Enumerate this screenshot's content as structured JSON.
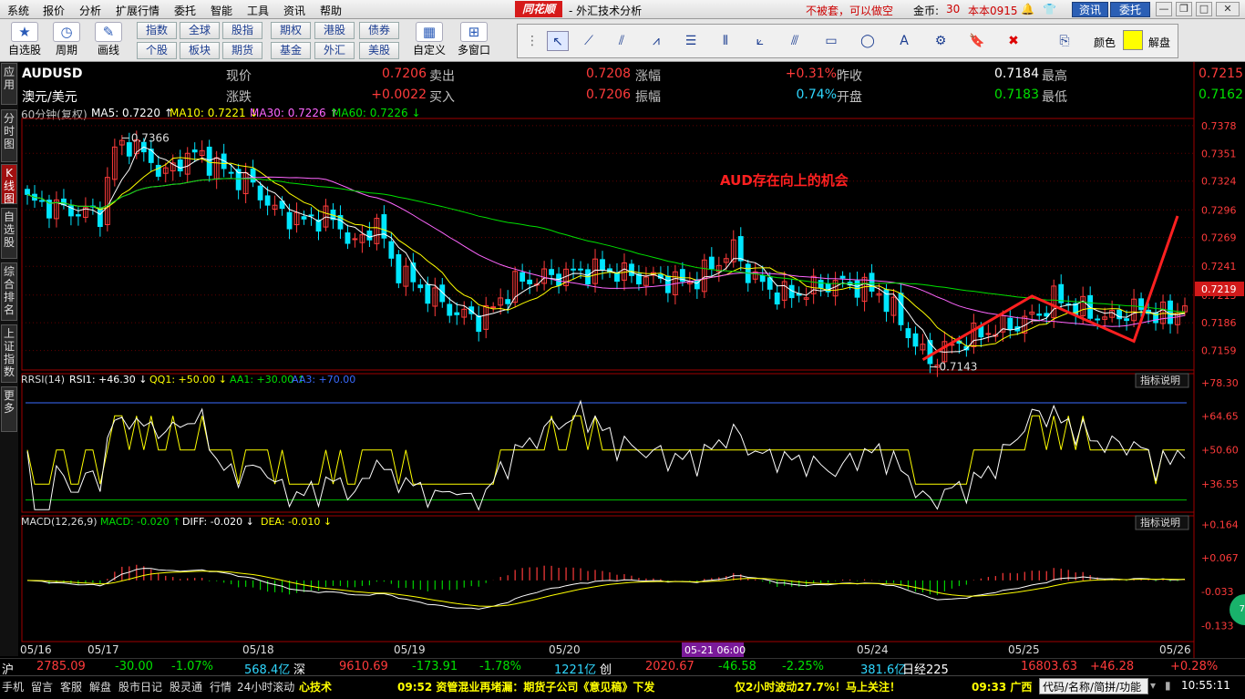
{
  "menu": {
    "items": [
      "系统",
      "报价",
      "分析",
      "扩展行情",
      "委托",
      "智能",
      "工具",
      "资讯",
      "帮助"
    ],
    "brand": "同花顺",
    "title": "- 外汇技术分析",
    "no_trap": "不被套，可以做空",
    "gold_label": "金币:",
    "gold_value": "30",
    "version": "本本0915",
    "news_button": "资讯",
    "trade_button": "委托"
  },
  "toolbar": {
    "big_tools": [
      "自选股",
      "周期",
      "画线"
    ],
    "grid_buttons": [
      [
        "指数",
        "全球",
        "股指",
        "期权",
        "港股",
        "债券"
      ],
      [
        "个股",
        "板块",
        "期货",
        "基金",
        "外汇",
        "美股"
      ]
    ],
    "custom": "自定义",
    "multi_window": "多窗口",
    "color_label": "颜色",
    "unlock_label": "解盘"
  },
  "side_tabs": [
    "应用",
    "分时图",
    "K线图",
    "自选股",
    "综合排名",
    "上证指数",
    "更多"
  ],
  "header": {
    "symbol": "AUDUSD",
    "name": "澳元/美元",
    "period": "60分钟(复权)",
    "rows": [
      [
        {
          "label": "现价",
          "value": "0.7206",
          "color": "red"
        },
        {
          "label": "卖出",
          "value": "0.7208",
          "color": "red"
        },
        {
          "label": "涨幅",
          "value": "+0.31%",
          "color": "red"
        },
        {
          "label": "昨收",
          "value": "0.7184",
          "color": "white"
        },
        {
          "label": "最高",
          "value": "0.7215",
          "color": "red"
        }
      ],
      [
        {
          "label": "涨跌",
          "value": "+0.0022",
          "color": "red"
        },
        {
          "label": "买入",
          "value": "0.7206",
          "color": "red"
        },
        {
          "label": "振幅",
          "value": "0.74%",
          "color": "cyan"
        },
        {
          "label": "开盘",
          "value": "0.7183",
          "color": "green"
        },
        {
          "label": "最低",
          "value": "0.7162",
          "color": "green"
        }
      ]
    ],
    "ma": [
      {
        "text": "MA5: 0.7220",
        "arrow": "↑",
        "color": "white"
      },
      {
        "text": "MA10: 0.7221",
        "arrow": "↓",
        "color": "yellow"
      },
      {
        "text": "MA30: 0.7226",
        "arrow": "↑",
        "color": "magenta"
      },
      {
        "text": "MA60: 0.7226",
        "arrow": "↓",
        "color": "green"
      }
    ]
  },
  "main_chart": {
    "annotation": "AUD存在向上的机会",
    "high_label": "0.7366",
    "low_label": "0.7143",
    "current_tag": "0.7219",
    "y_ticks": [
      "0.7378",
      "0.7351",
      "0.7324",
      "0.7296",
      "0.7269",
      "0.7241",
      "0.7213",
      "0.7186",
      "0.7159"
    ]
  },
  "rsi": {
    "title": "RRSI(14)",
    "items": [
      {
        "text": "RSI1: +46.30",
        "arrow": "↓",
        "color": "white"
      },
      {
        "text": "QQ1: +50.00",
        "arrow": "↓",
        "color": "yellow"
      },
      {
        "text": "AA1: +30.00",
        "arrow": "↑",
        "color": "green"
      },
      {
        "text": "AA3: +70.00",
        "arrow": "",
        "color": "blue"
      }
    ],
    "explain": "指标说明",
    "y_ticks": [
      "+78.30",
      "+64.65",
      "+50.60",
      "+36.55"
    ]
  },
  "macd": {
    "title": "MACD(12,26,9)",
    "items": [
      {
        "text": "MACD: -0.020",
        "arrow": "↑",
        "color": "green"
      },
      {
        "text": "DIFF: -0.020",
        "arrow": "↓",
        "color": "white"
      },
      {
        "text": "DEA: -0.010",
        "arrow": "↓",
        "color": "yellow"
      }
    ],
    "explain": "指标说明",
    "y_ticks": [
      "+0.164",
      "+0.067",
      "-0.033",
      "-0.133"
    ]
  },
  "x_axis": {
    "labels": [
      "05/16",
      "05/17",
      "05/18",
      "05/19",
      "05/20",
      "05/24",
      "05/25",
      "05/26"
    ],
    "cursor": "05-21 06:00"
  },
  "chart_data": {
    "type": "candlestick",
    "symbol": "AUDUSD",
    "period": "60分钟(复权)",
    "ylim": [
      0.714,
      0.7385
    ],
    "x_labels": [
      "05/16",
      "05/17",
      "05/18",
      "05/19",
      "05/20",
      "05/24",
      "05/25",
      "05/26"
    ],
    "close_path": [
      {
        "t": 0,
        "v": 0.7305
      },
      {
        "t": 3,
        "v": 0.73
      },
      {
        "t": 6,
        "v": 0.7295
      },
      {
        "t": 10,
        "v": 0.7292
      },
      {
        "t": 12,
        "v": 0.7355
      },
      {
        "t": 14,
        "v": 0.7362
      },
      {
        "t": 16,
        "v": 0.735
      },
      {
        "t": 19,
        "v": 0.733
      },
      {
        "t": 22,
        "v": 0.735
      },
      {
        "t": 24,
        "v": 0.7348
      },
      {
        "t": 28,
        "v": 0.733
      },
      {
        "t": 31,
        "v": 0.732
      },
      {
        "t": 34,
        "v": 0.7295
      },
      {
        "t": 38,
        "v": 0.7285
      },
      {
        "t": 41,
        "v": 0.729
      },
      {
        "t": 43,
        "v": 0.728
      },
      {
        "t": 45,
        "v": 0.726
      },
      {
        "t": 48,
        "v": 0.7285
      },
      {
        "t": 50,
        "v": 0.7245
      },
      {
        "t": 53,
        "v": 0.7225
      },
      {
        "t": 56,
        "v": 0.721
      },
      {
        "t": 59,
        "v": 0.7195
      },
      {
        "t": 62,
        "v": 0.719
      },
      {
        "t": 64,
        "v": 0.72
      },
      {
        "t": 67,
        "v": 0.7225
      },
      {
        "t": 71,
        "v": 0.723
      },
      {
        "t": 75,
        "v": 0.7235
      },
      {
        "t": 79,
        "v": 0.7238
      },
      {
        "t": 83,
        "v": 0.7232
      },
      {
        "t": 87,
        "v": 0.7228
      },
      {
        "t": 91,
        "v": 0.7225
      },
      {
        "t": 94,
        "v": 0.724
      },
      {
        "t": 97,
        "v": 0.7258
      },
      {
        "t": 99,
        "v": 0.7235
      },
      {
        "t": 102,
        "v": 0.7218
      },
      {
        "t": 105,
        "v": 0.7212
      },
      {
        "t": 108,
        "v": 0.722
      },
      {
        "t": 111,
        "v": 0.7225
      },
      {
        "t": 114,
        "v": 0.7222
      },
      {
        "t": 117,
        "v": 0.7215
      },
      {
        "t": 119,
        "v": 0.7198
      },
      {
        "t": 122,
        "v": 0.7165
      },
      {
        "t": 124,
        "v": 0.7148
      },
      {
        "t": 126,
        "v": 0.716
      },
      {
        "t": 129,
        "v": 0.717
      },
      {
        "t": 132,
        "v": 0.7178
      },
      {
        "t": 136,
        "v": 0.7185
      },
      {
        "t": 139,
        "v": 0.7195
      },
      {
        "t": 141,
        "v": 0.721
      },
      {
        "t": 143,
        "v": 0.7205
      },
      {
        "t": 146,
        "v": 0.7195
      },
      {
        "t": 149,
        "v": 0.719
      },
      {
        "t": 152,
        "v": 0.72
      },
      {
        "t": 155,
        "v": 0.7195
      },
      {
        "t": 157,
        "v": 0.719
      },
      {
        "t": 159,
        "v": 0.7206
      }
    ],
    "total_bars": 160,
    "overlays": {
      "MA5": 0.722,
      "MA10": 0.7221,
      "MA30": 0.7226,
      "MA60": 0.7226
    },
    "annotation_zigzag": [
      {
        "t": 123,
        "v": 0.715
      },
      {
        "t": 138,
        "v": 0.7212
      },
      {
        "t": 152,
        "v": 0.7168
      },
      {
        "t": 158,
        "v": 0.729
      }
    ],
    "colors": {
      "up": "#ff3b3b",
      "down": "#00e6ff",
      "ma5": "#ffffff",
      "ma10": "#ffff00",
      "ma30": "#ff66ff",
      "ma60": "#00e000",
      "zigzag": "#ff2020"
    }
  }
}
